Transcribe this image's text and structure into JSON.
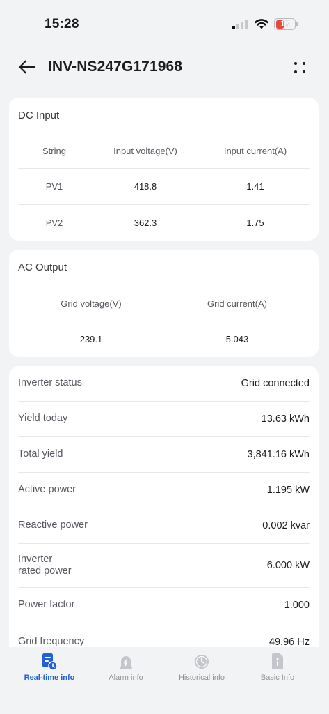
{
  "status_bar": {
    "time": "15:28",
    "battery": "17"
  },
  "header": {
    "title": "INV-NS247G171968"
  },
  "dc_input": {
    "title": "DC Input",
    "columns": [
      "String",
      "Input voltage(V)",
      "Input current(A)"
    ],
    "rows": [
      {
        "string": "PV1",
        "voltage": "418.8",
        "current": "1.41"
      },
      {
        "string": "PV2",
        "voltage": "362.3",
        "current": "1.75"
      }
    ]
  },
  "ac_output": {
    "title": "AC Output",
    "columns": [
      "Grid voltage(V)",
      "Grid current(A)"
    ],
    "row": {
      "voltage": "239.1",
      "current": "5.043"
    }
  },
  "info": [
    {
      "label": "Inverter status",
      "value": "Grid connected"
    },
    {
      "label": "Yield today",
      "value": "13.63  kWh"
    },
    {
      "label": "Total yield",
      "value": "3,841.16 kWh"
    },
    {
      "label": "Active power",
      "value": "1.195 kW"
    },
    {
      "label": "Reactive power",
      "value": "0.002 kvar"
    },
    {
      "label_line1": "Inverter",
      "label_line2": "rated power",
      "value": "6.000 kW"
    },
    {
      "label": "Power factor",
      "value": "1.000"
    },
    {
      "label": "Grid frequency",
      "value": "49.96 Hz"
    }
  ],
  "tabs": [
    {
      "label": "Real-time info",
      "icon": "realtime-doc-icon",
      "active": true
    },
    {
      "label": "Alarm info",
      "icon": "alarm-icon",
      "active": false
    },
    {
      "label": "Historical info",
      "icon": "clock-icon",
      "active": false
    },
    {
      "label": "Basic Info",
      "icon": "info-doc-icon",
      "active": false
    }
  ],
  "colors": {
    "accent": "#2160d6",
    "inactive": "#8e9196",
    "background": "#f2f3f5",
    "battery_low": "#e8493f"
  }
}
